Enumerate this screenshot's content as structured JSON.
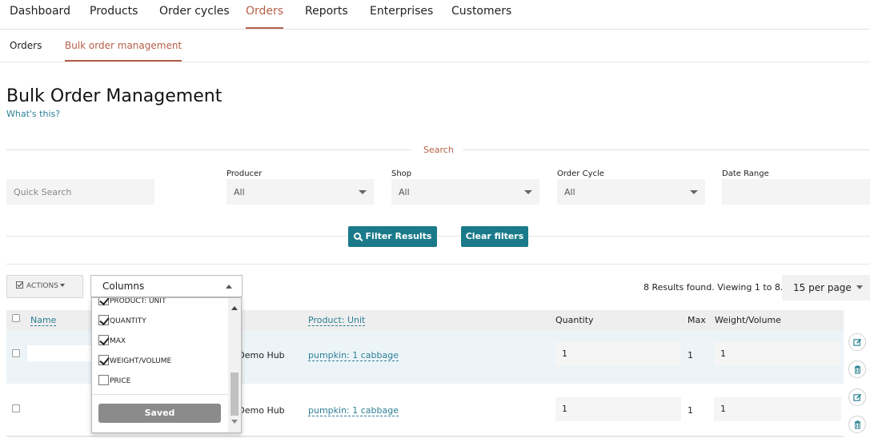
{
  "topnav": {
    "items": [
      "Dashboard",
      "Products",
      "Order cycles",
      "Orders",
      "Reports",
      "Enterprises",
      "Customers"
    ],
    "active": "Orders"
  },
  "subnav": {
    "items": [
      "Orders",
      "Bulk order management"
    ],
    "active": "Bulk order management"
  },
  "page": {
    "title": "Bulk Order Management",
    "help_link": "What's this?"
  },
  "search": {
    "section_label": "Search",
    "quick_search_placeholder": "Quick Search",
    "producer": {
      "label": "Producer",
      "value": "All"
    },
    "shop": {
      "label": "Shop",
      "value": "All"
    },
    "order_cycle": {
      "label": "Order Cycle",
      "value": "All"
    },
    "date_range": {
      "label": "Date Range",
      "value": ""
    },
    "filter_button": "Filter Results",
    "clear_button": "Clear filters"
  },
  "toolbar": {
    "actions_label": "ACTIONS",
    "columns_label": "Columns",
    "results_text": "8 Results found. Viewing 1 to 8.",
    "per_page": "15 per page"
  },
  "columns_dropdown": {
    "options": [
      {
        "label": "PRODUCT: UNIT",
        "checked": true
      },
      {
        "label": "QUANTITY",
        "checked": true
      },
      {
        "label": "MAX",
        "checked": true
      },
      {
        "label": "WEIGHT/VOLUME",
        "checked": true
      },
      {
        "label": "PRICE",
        "checked": false
      }
    ],
    "saved_label": "Saved"
  },
  "table": {
    "headers": {
      "name": "Name",
      "product_unit": "Product: Unit",
      "quantity": "Quantity",
      "max": "Max",
      "weight_volume": "Weight/Volume"
    },
    "rows": [
      {
        "shop": "e Demo Hub",
        "product": "pumpkin: 1 cabbage",
        "quantity": "1",
        "max": "1",
        "weight": "1"
      },
      {
        "shop": "e Demo Hub",
        "product": "pumpkin: 1 cabbage",
        "quantity": "1",
        "max": "1",
        "weight": "1"
      }
    ]
  },
  "colors": {
    "accent": "#b55f47",
    "teal": "#1a7a89",
    "link": "#2b7f95"
  }
}
